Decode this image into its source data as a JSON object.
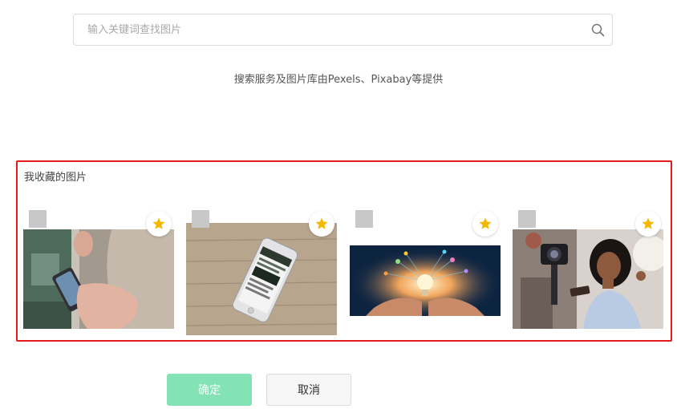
{
  "search": {
    "placeholder": "输入关键词查找图片",
    "value": "",
    "icon": "search-icon"
  },
  "provider_note": "搜索服务及图片库由Pexels、Pixabay等提供",
  "favorites": {
    "title": "我收藏的图片",
    "items": [
      {
        "subject": "hand-holding-phone-on-subway",
        "favorited": true,
        "selected": false
      },
      {
        "subject": "smartphone-on-wooden-table",
        "favorited": true,
        "selected": false
      },
      {
        "subject": "glowing-lightbulb-in-hands",
        "favorited": true,
        "selected": false
      },
      {
        "subject": "woman-vlogging-with-camera",
        "favorited": true,
        "selected": false
      }
    ],
    "star_color": "#f5b800",
    "border_color": "#e31b1b"
  },
  "actions": {
    "confirm_label": "确定",
    "cancel_label": "取消",
    "confirm_color": "#84e3b5"
  }
}
